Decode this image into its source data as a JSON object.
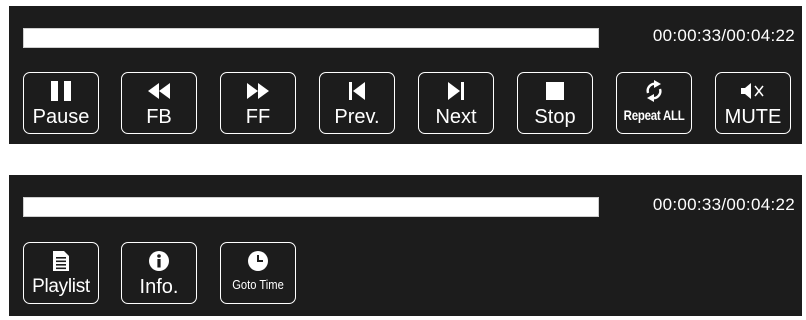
{
  "player_top": {
    "time": "00:00:33/00:04:22",
    "progress": 0.0,
    "buttons": [
      {
        "label": "Pause",
        "icon": "pause-icon"
      },
      {
        "label": "FB",
        "icon": "fast-backward-icon"
      },
      {
        "label": "FF",
        "icon": "fast-forward-icon"
      },
      {
        "label": "Prev.",
        "icon": "previous-icon"
      },
      {
        "label": "Next",
        "icon": "next-icon"
      },
      {
        "label": "Stop",
        "icon": "stop-icon"
      },
      {
        "label": "Repeat ALL",
        "icon": "repeat-icon"
      },
      {
        "label": "MUTE",
        "icon": "mute-icon"
      }
    ]
  },
  "player_bottom": {
    "time": "00:00:33/00:04:22",
    "progress": 0.0,
    "buttons": [
      {
        "label": "Playlist",
        "icon": "playlist-icon"
      },
      {
        "label": "Info.",
        "icon": "info-icon"
      },
      {
        "label": "Goto Time",
        "icon": "clock-icon"
      }
    ]
  },
  "colors": {
    "panel": "#1c1c1c",
    "foreground": "#ffffff"
  }
}
